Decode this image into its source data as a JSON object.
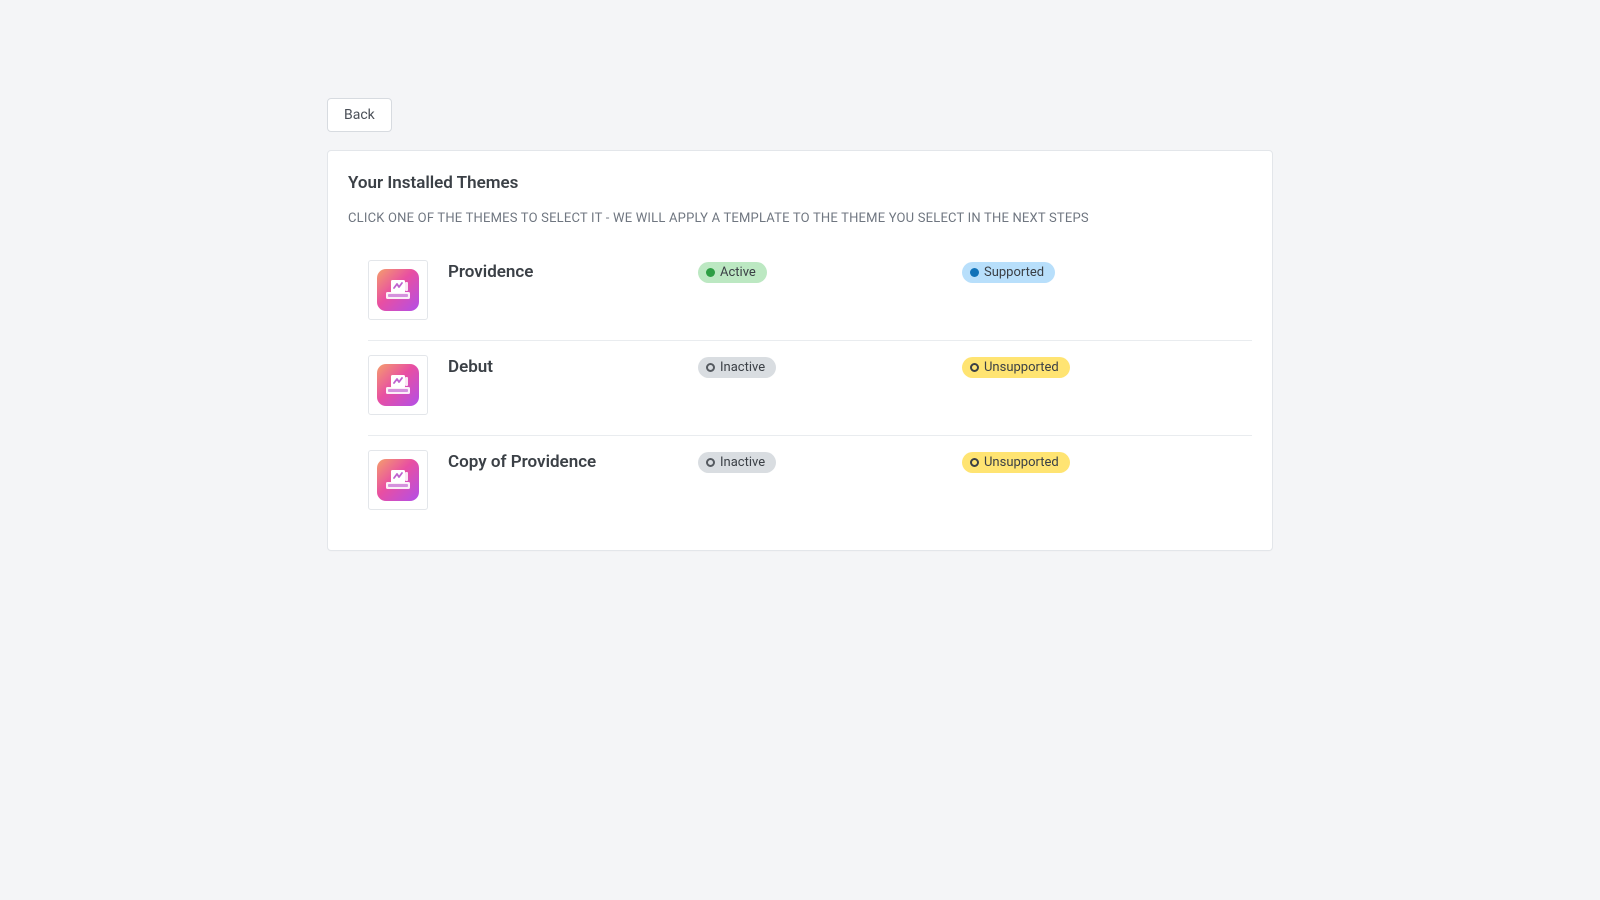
{
  "header": {
    "back_label": "Back"
  },
  "card": {
    "title": "Your Installed Themes",
    "subtitle": "CLICK ONE OF THE THEMES TO SELECT IT - WE WILL APPLY A TEMPLATE TO THE THEME YOU SELECT IN THE NEXT STEPS"
  },
  "status": {
    "active": "Active",
    "inactive": "Inactive",
    "supported": "Supported",
    "unsupported": "Unsupported"
  },
  "themes": [
    {
      "name": "Providence",
      "active": true,
      "supported": true
    },
    {
      "name": "Debut",
      "active": false,
      "supported": false
    },
    {
      "name": "Copy of Providence",
      "active": false,
      "supported": false
    }
  ]
}
